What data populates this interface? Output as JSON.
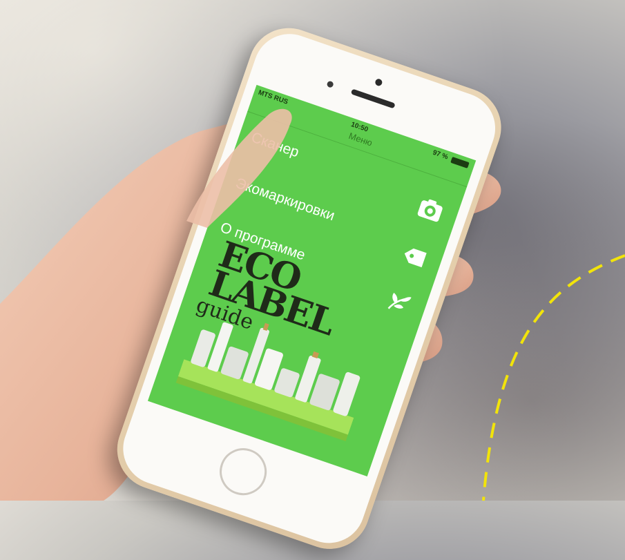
{
  "status_bar": {
    "carrier": "MTS RUS",
    "time": "10:50",
    "battery": "97 %"
  },
  "nav": {
    "title": "Меню"
  },
  "menu": [
    {
      "label": "Сканер",
      "icon": "camera-icon"
    },
    {
      "label": "Экомаркировки",
      "icon": "tag-icon"
    },
    {
      "label": "О программе",
      "icon": "leaf-icon"
    }
  ],
  "logo": {
    "line1": "ECO",
    "line2": "LABEL",
    "line3": "guide"
  },
  "colors": {
    "screen_green": "#5dcc4d",
    "phone_gold": "#e7d2b0",
    "accent_dash": "#f2e40a"
  }
}
